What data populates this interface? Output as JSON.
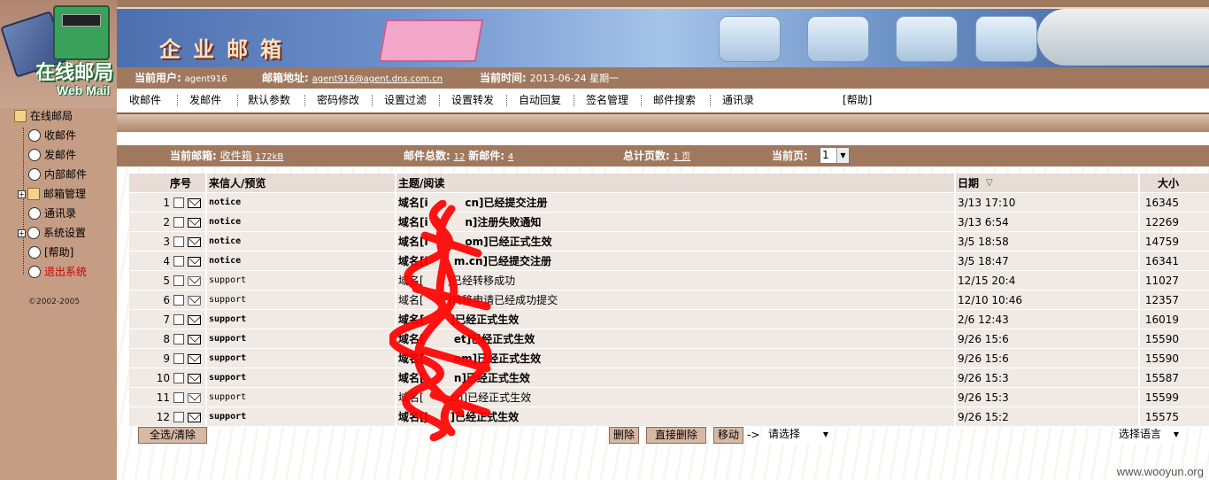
{
  "logo": {
    "cn": "在线邮局",
    "en": "Web Mail"
  },
  "banner": {
    "title": "企业邮箱"
  },
  "info": {
    "user_label": "当前用户:",
    "user_value": "agent916",
    "mailbox_label": "邮箱地址:",
    "mailbox_value": "agent916@agent.dns.com.cn",
    "time_label": "当前时间:",
    "time_value": "2013-06-24 星期一"
  },
  "menu": [
    "收邮件",
    "发邮件",
    "默认参数",
    "密码修改",
    "设置过滤",
    "设置转发",
    "自动回复",
    "签名管理",
    "邮件搜索",
    "通讯录",
    "[帮助]"
  ],
  "tree": {
    "root": "在线邮局",
    "items": [
      "收邮件",
      "发邮件",
      "内部邮件",
      "邮箱管理",
      "通讯录",
      "系统设置",
      "[帮助]",
      "退出系统"
    ]
  },
  "copyright": "©2002-2005",
  "status": {
    "mailbox_label": "当前邮箱:",
    "mailbox_value": "收件箱",
    "mailbox_size": "172kB",
    "total_label": "邮件总数:",
    "total_value": "12",
    "new_label": "新邮件:",
    "new_value": "4",
    "pages_label": "总计页数:",
    "pages_value": "1 页",
    "current_label": "当前页:",
    "current_value": "1"
  },
  "table": {
    "headers": [
      "序号",
      "来信人/预览",
      "主题/阅读",
      "日期",
      "大小"
    ],
    "rows": [
      {
        "no": "1",
        "from": "notice",
        "subject": "域名[i          cn]已经提交注册",
        "date": "3/13 17:10",
        "size": "16345",
        "unread": true
      },
      {
        "no": "2",
        "from": "notice",
        "subject": "域名[i          n]注册失败通知",
        "date": "3/13 6:54",
        "size": "12269",
        "unread": true
      },
      {
        "no": "3",
        "from": "notice",
        "subject": "域名[i          om]已经正式生效",
        "date": "3/5 18:58",
        "size": "14759",
        "unread": true
      },
      {
        "no": "4",
        "from": "notice",
        "subject": "域名[i       m.cn]已经提交注册",
        "date": "3/5 18:47",
        "size": "16341",
        "unread": true
      },
      {
        "no": "5",
        "from": "support",
        "subject": "域名[       ]已经转移成功",
        "date": "12/15 20:4",
        "size": "11027",
        "unread": false
      },
      {
        "no": "6",
        "from": "support",
        "subject": "域名[       ]转移申请已经成功提交",
        "date": "12/10 10:46",
        "size": "12357",
        "unread": false
      },
      {
        "no": "7",
        "from": "support",
        "subject": "域名[       ]已经正式生效",
        "date": "2/6 12:43",
        "size": "16019",
        "unread": true
      },
      {
        "no": "8",
        "from": "support",
        "subject": "域名[        et]已经正式生效",
        "date": "9/26 15:6",
        "size": "15590",
        "unread": true
      },
      {
        "no": "9",
        "from": "support",
        "subject": "域名[        om]已经正式生效",
        "date": "9/26 15:6",
        "size": "15590",
        "unread": true
      },
      {
        "no": "10",
        "from": "support",
        "subject": "域名[        n]已经正式生效",
        "date": "9/26 15:3",
        "size": "15587",
        "unread": true
      },
      {
        "no": "11",
        "from": "support",
        "subject": "域名[       .cn]已经正式生效",
        "date": "9/26 15:3",
        "size": "15599",
        "unread": false
      },
      {
        "no": "12",
        "from": "support",
        "subject": "域名[j      ]已经正式生效",
        "date": "9/26 15:2",
        "size": "15575",
        "unread": true
      }
    ]
  },
  "actions": {
    "select_all": "全选/清除",
    "delete": "删除",
    "direct_delete": "直接删除",
    "move": "移动",
    "arrow": "->",
    "move_target": "请选择",
    "language": "选择语言"
  },
  "watermark": "www.wooyun.org",
  "colors": {
    "brown": "#a0785e",
    "sidebar": "#c59d84",
    "row": "#f0e9e4",
    "exit": "#cc0000"
  }
}
